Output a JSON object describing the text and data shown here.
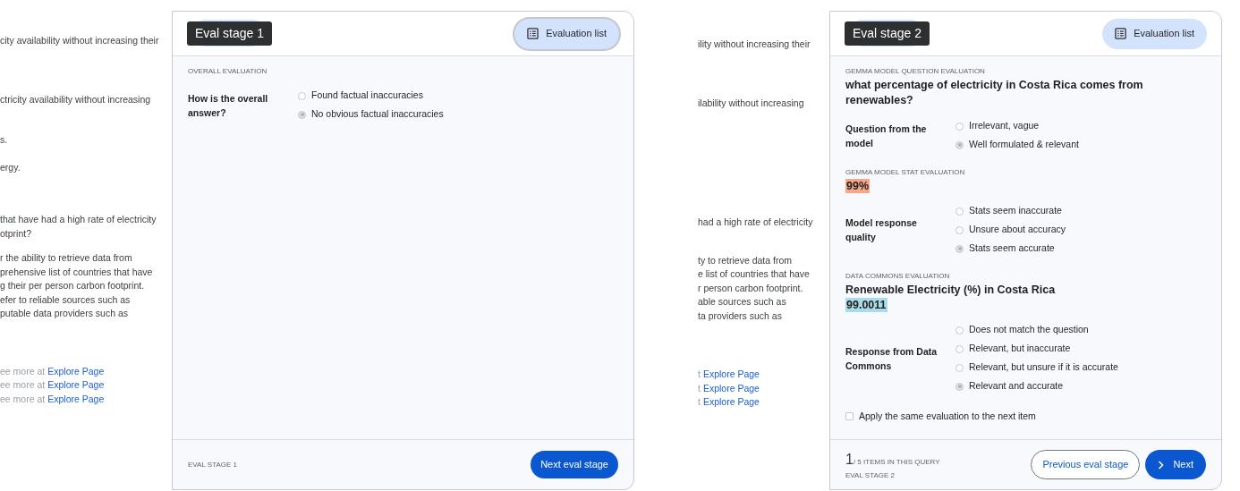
{
  "panels": [
    {
      "context": [
        {
          "lines": [
            {
              "text": "city availability without increasing their"
            }
          ]
        },
        {
          "lines": [
            {
              "text": "ctricity availability without increasing"
            }
          ]
        },
        {
          "lines": [
            {
              "text": "s."
            }
          ]
        },
        {
          "lines": [
            {
              "text": "ergy."
            }
          ]
        },
        {
          "lines": [
            {
              "text": "that have had a high rate of electricity"
            },
            {
              "text": "otprint?"
            }
          ]
        },
        {
          "lines": [
            {
              "text": "r the ability to retrieve data from"
            },
            {
              "text": "prehensive list of countries that have"
            },
            {
              "text": "g their per person carbon footprint."
            },
            {
              "text": "efer to reliable sources such as"
            },
            {
              "text": "putable data providers such as"
            }
          ]
        },
        {
          "lines": [
            {
              "text": "ee more at",
              "link": "Explore Page"
            },
            {
              "text": "ee more at",
              "link": "Explore Page"
            },
            {
              "text": "ee more at",
              "link": "Explore Page"
            }
          ]
        }
      ],
      "stage_tag": "Eval stage 1",
      "evaluation_list_button": {
        "label": "Evaluation list",
        "focused": true
      },
      "sections": [
        {
          "heading": "OVERALL EVALUATION",
          "questions": [
            {
              "label": "How is the overall answer?",
              "options": [
                {
                  "label": "Found factual inaccuracies",
                  "selected": false
                },
                {
                  "label": "No obvious factual inaccuracies",
                  "selected": true
                }
              ]
            }
          ]
        }
      ],
      "footer": {
        "stage": "EVAL STAGE 1",
        "buttons": [
          {
            "label": "Next eval stage",
            "kind": "filled"
          }
        ]
      }
    },
    {
      "context": [
        {
          "lines": [
            {
              "text": "ility without increasing their"
            }
          ]
        },
        {
          "lines": [
            {
              "text": "ilability without increasing"
            }
          ]
        },
        {
          "lines": [
            {
              "text": "had a high rate of electricity"
            }
          ]
        },
        {
          "lines": [
            {
              "text": "ty to retrieve data from"
            },
            {
              "text": "e list of countries that have"
            },
            {
              "text": "r person carbon footprint."
            },
            {
              "text": "able sources such as"
            },
            {
              "text": "ta providers such as"
            }
          ]
        },
        {
          "lines": [
            {
              "text": "t",
              "link": "Explore Page"
            },
            {
              "text": "t",
              "link": "Explore Page"
            },
            {
              "text": "t",
              "link": "Explore Page"
            }
          ]
        }
      ],
      "stage_tag": "Eval stage 2",
      "evaluation_list_button": {
        "label": "Evaluation list",
        "focused": false
      },
      "sections": [
        {
          "heading": "GEMMA MODEL QUESTION EVALUATION",
          "title": "what percentage of electricity in Costa Rica comes from renewables?",
          "questions": [
            {
              "label": "Question from the model",
              "options": [
                {
                  "label": "Irrelevant, vague",
                  "selected": false
                },
                {
                  "label": "Well formulated & relevant",
                  "selected": true
                }
              ]
            }
          ]
        },
        {
          "heading": "GEMMA MODEL STAT EVALUATION",
          "value": {
            "text": "99%",
            "color": "#f6a68b"
          },
          "questions": [
            {
              "label": "Model response quality",
              "options": [
                {
                  "label": "Stats seem inaccurate",
                  "selected": false
                },
                {
                  "label": "Unsure about accuracy",
                  "selected": false
                },
                {
                  "label": "Stats seem accurate",
                  "selected": true
                }
              ]
            }
          ]
        },
        {
          "heading": "DATA COMMONS EVALUATION",
          "title": "Renewable Electricity (%) in Costa Rica",
          "value": {
            "text": "99.0011",
            "color": "#a9dbe8"
          },
          "questions": [
            {
              "label": "Response from Data Commons",
              "options": [
                {
                  "label": "Does not match the question",
                  "selected": false
                },
                {
                  "label": "Relevant, but inaccurate",
                  "selected": false
                },
                {
                  "label": "Relevant, but unsure if it is accurate",
                  "selected": false
                },
                {
                  "label": "Relevant and accurate",
                  "selected": true
                }
              ]
            }
          ]
        }
      ],
      "apply_checkbox": {
        "label": "Apply the same evaluation to the next item",
        "checked": false
      },
      "footer": {
        "counter": "1",
        "counter_label": "/ 5 ITEMS IN THIS QUERY",
        "stage": "EVAL STAGE 2",
        "buttons": [
          {
            "label": "Previous eval stage",
            "kind": "outlined"
          },
          {
            "label": "Next",
            "kind": "filled_icon"
          }
        ]
      }
    }
  ]
}
